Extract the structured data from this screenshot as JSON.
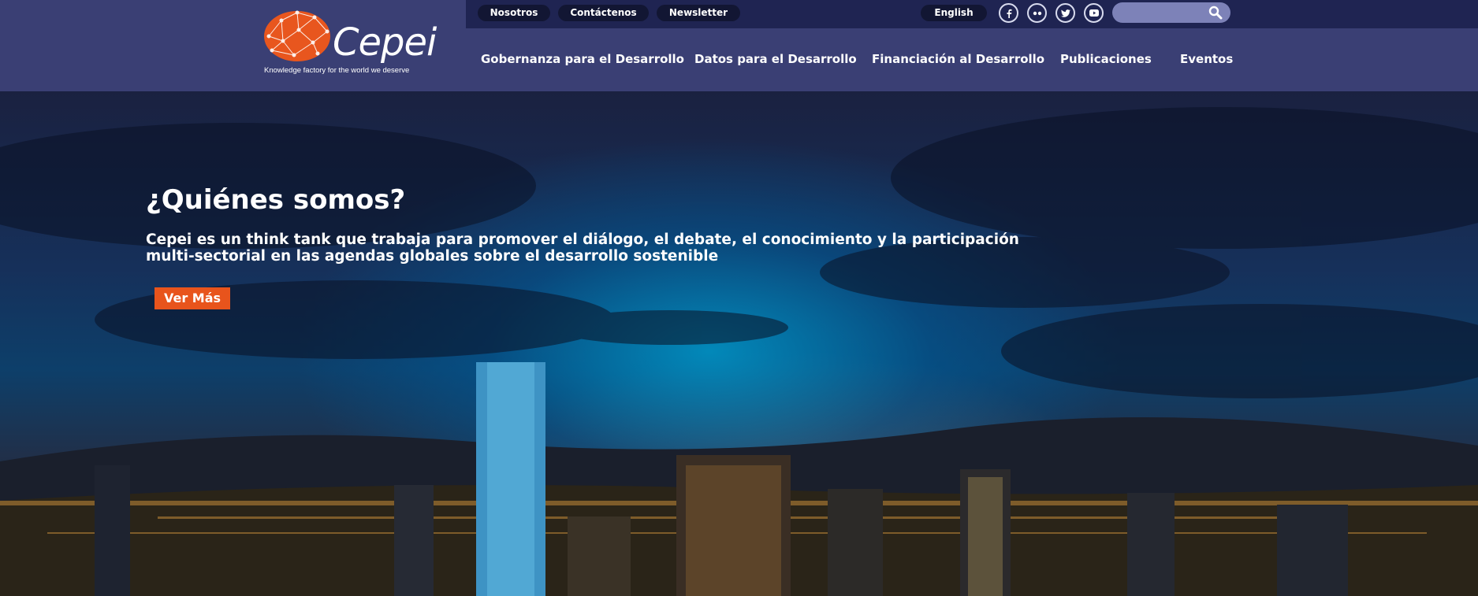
{
  "brand": {
    "name": "Cepei",
    "tagline": "Knowledge factory for the world we deserve",
    "logo_color": "#e8561e"
  },
  "topbar": {
    "links": [
      "Nosotros",
      "Contáctenos",
      "Newsletter"
    ],
    "language": "English",
    "social_icons": [
      "facebook-icon",
      "flickr-icon",
      "twitter-icon",
      "youtube-icon"
    ],
    "search_placeholder": ""
  },
  "main_nav": {
    "items": [
      "Gobernanza para el Desarrollo",
      "Datos para el Desarrollo",
      "Financiación al Desarrollo",
      "Publicaciones",
      "Eventos"
    ]
  },
  "hero": {
    "title": "¿Quiénes somos?",
    "description": "Cepei es un think tank que trabaja para promover el diálogo, el debate, el conocimiento y la participación multi-sectorial en las agendas globales sobre el desarrollo sostenible",
    "cta_label": "Ver Más"
  },
  "colors": {
    "header_bg": "#3a3f74",
    "topbar_bg": "#1f2452",
    "accent": "#e8541c"
  }
}
